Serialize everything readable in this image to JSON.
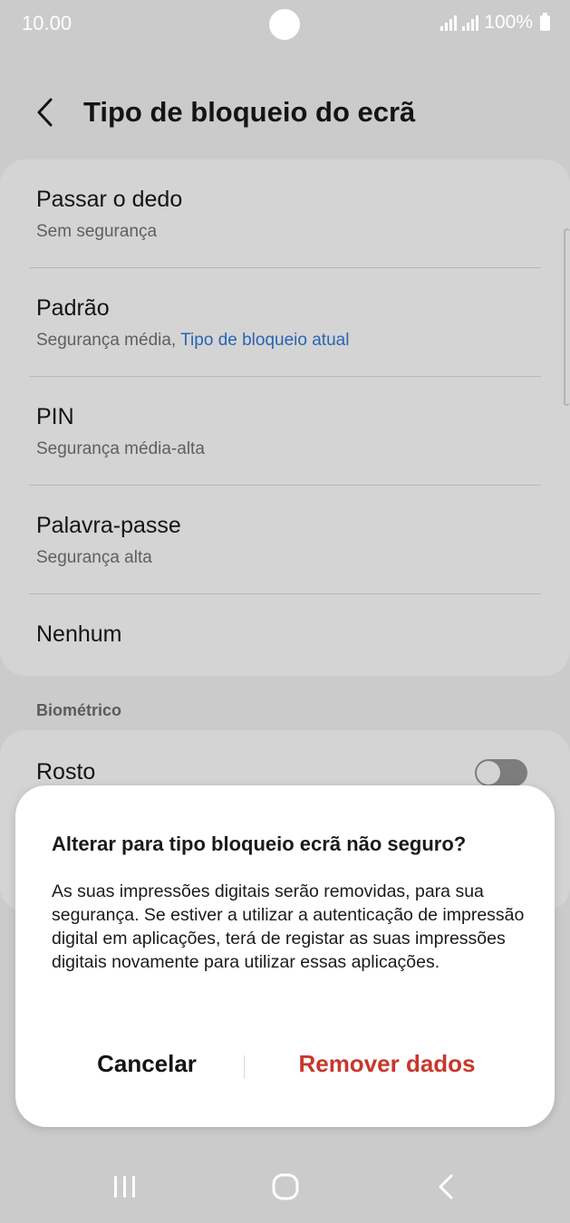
{
  "status_bar": {
    "time": "10.00",
    "battery": "100%"
  },
  "header": {
    "title": "Tipo de bloqueio do ecrã"
  },
  "lock_types": [
    {
      "title": "Passar o dedo",
      "subtitle": "Sem segurança"
    },
    {
      "title": "Padrão",
      "subtitle": "Segurança média, ",
      "subtitle_accent": "Tipo de bloqueio atual"
    },
    {
      "title": "PIN",
      "subtitle": "Segurança média-alta"
    },
    {
      "title": "Palavra-passe",
      "subtitle": "Segurança alta"
    },
    {
      "title": "Nenhum"
    }
  ],
  "biometric": {
    "section_label": "Biométrico",
    "face": {
      "title": "Rosto",
      "enabled": false
    }
  },
  "dialog": {
    "title": "Alterar para tipo bloqueio ecrã não seguro?",
    "body": "As suas impressões digitais serão removidas, para sua segurança. Se estiver a utilizar a autenticação de impressão digital em aplicações, terá de registar as suas impressões digitais novamente para utilizar essas aplicações.",
    "cancel_label": "Cancelar",
    "confirm_label": "Remover dados"
  },
  "colors": {
    "accent": "#2a64b5",
    "destructive": "#c9372c",
    "background": "#cbcbcb"
  },
  "icons": {
    "back": "chevron-left-icon",
    "nav_recents": "recents-icon",
    "nav_home": "home-icon",
    "nav_back": "back-icon"
  }
}
